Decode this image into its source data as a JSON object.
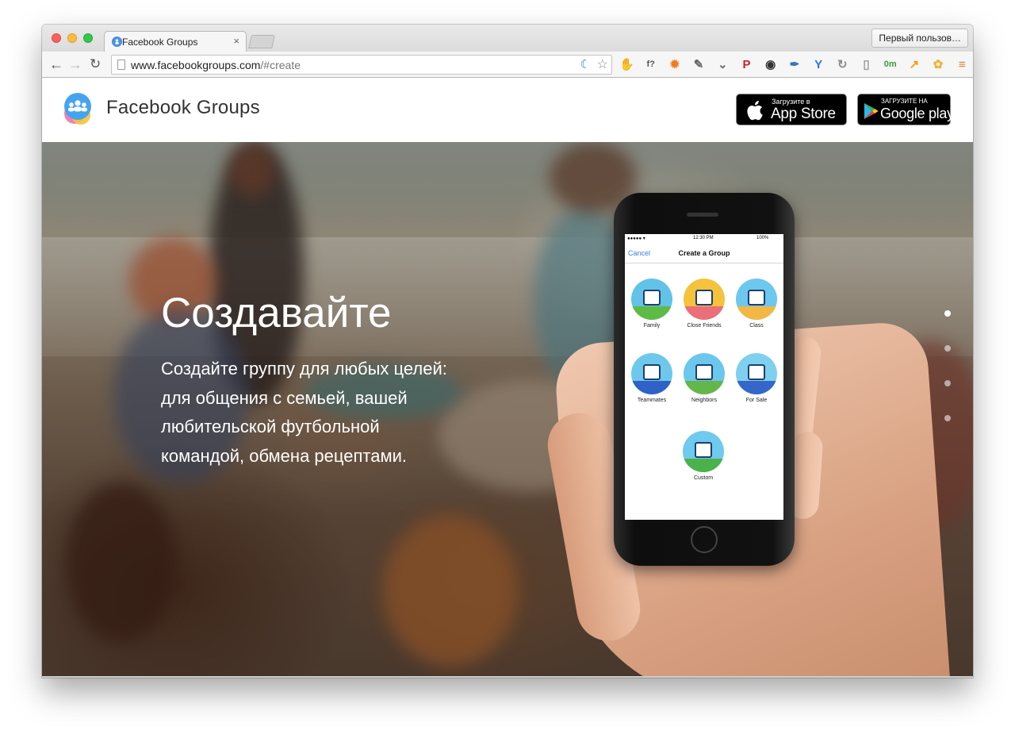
{
  "browser": {
    "tab_title": "Facebook Groups",
    "tab_close": "×",
    "profile_label": "Первый пользов…",
    "url_host": "www.facebookgroups.com",
    "url_path": "/#create",
    "extensions": [
      {
        "icon": "adblock-icon",
        "glyph": "✋",
        "color": "#d94036"
      },
      {
        "icon": "font-finder-icon",
        "glyph": "f?",
        "color": "#555555"
      },
      {
        "icon": "firebug-icon",
        "glyph": "✹",
        "color": "#f07b1d"
      },
      {
        "icon": "evernote-icon",
        "glyph": "✎",
        "color": "#666666"
      },
      {
        "icon": "pocket-icon",
        "glyph": "⌄",
        "color": "#6e6e6e"
      },
      {
        "icon": "pinterest-icon",
        "glyph": "P",
        "color": "#cb2027"
      },
      {
        "icon": "color-picker-icon",
        "glyph": "◉",
        "color": "#333333"
      },
      {
        "icon": "eyedropper-icon",
        "glyph": "✒",
        "color": "#2f6fb8"
      },
      {
        "icon": "y-icon",
        "glyph": "Y",
        "color": "#2a7bd6"
      },
      {
        "icon": "sync-icon",
        "glyph": "↻",
        "color": "#8c8c8c"
      },
      {
        "icon": "reader-icon",
        "glyph": "▯",
        "color": "#9a9a9a"
      },
      {
        "icon": "timer-icon",
        "glyph": "0m",
        "color": "#3c9a3c"
      },
      {
        "icon": "stats-icon",
        "glyph": "↗",
        "color": "#f39c12"
      },
      {
        "icon": "flower-icon",
        "glyph": "✿",
        "color": "#f0b23b"
      },
      {
        "icon": "menu-icon",
        "glyph": "≡",
        "color": "#e07b20"
      }
    ]
  },
  "header": {
    "title": "Facebook Groups",
    "appstore_small": "Загрузите в",
    "appstore_big": "App Store",
    "google_small": "ЗАГРУЗИТЕ НА",
    "google_big": "Google play"
  },
  "hero": {
    "heading": "Создавайте",
    "text": "Создайте группу для любых целей: для общения с семьей, вашей любительской футбольной командой, обмена рецептами.",
    "slides": 4,
    "active_slide": 1
  },
  "phone": {
    "time": "12:30 PM",
    "battery": "100%",
    "cancel": "Cancel",
    "title": "Create a Group",
    "categories": [
      {
        "label": "Family",
        "color": "#62c2e8",
        "accent": "#5dbb46",
        "icon": "house-icon"
      },
      {
        "label": "Close Friends",
        "color": "#f5c23b",
        "accent": "#ea6f7a",
        "icon": "friends-icon"
      },
      {
        "label": "Class",
        "color": "#6cc8ee",
        "accent": "#f2b744",
        "icon": "classroom-icon"
      },
      {
        "label": "Teammates",
        "color": "#6dc8ec",
        "accent": "#2f62c7",
        "icon": "pennant-icon"
      },
      {
        "label": "Neighbors",
        "color": "#6bc7ec",
        "accent": "#64b64a",
        "icon": "neighborhood-icon"
      },
      {
        "label": "For Sale",
        "color": "#7fd0ef",
        "accent": "#3566c9",
        "icon": "shopping-bag-icon"
      },
      {
        "label": "Custom",
        "color": "#70c9ee",
        "accent": "#4bb24b",
        "icon": "custom-easel-icon"
      }
    ]
  }
}
